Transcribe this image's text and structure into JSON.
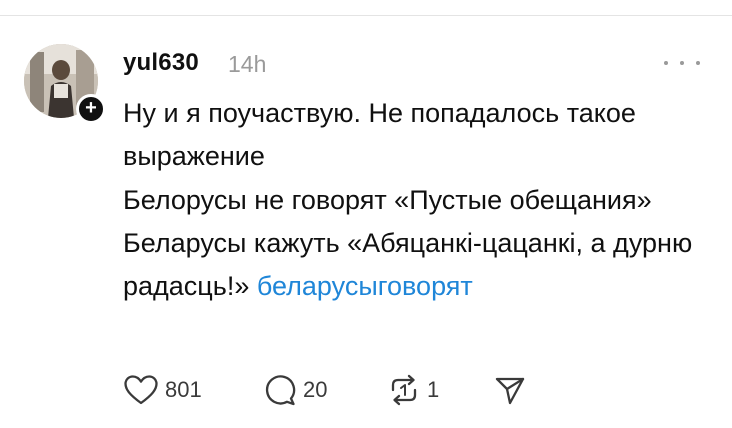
{
  "post": {
    "username": "yul630",
    "timestamp": "14h",
    "lines": [
      "Ну и я поучаствую. Не попадалось такое выражение",
      "Белорусы не говорят «Пустые обещания»"
    ],
    "last_line": "Беларусы кажуть «Абяцанкі-цацанкі, а дурню радасць!»",
    "hashtag": "беларусыговорят"
  },
  "actions": {
    "likes": "801",
    "replies": "20",
    "reposts": "1"
  },
  "icons": {
    "more": "more-horizontal-icon",
    "like": "heart-icon",
    "reply": "speech-bubble-icon",
    "repost": "repost-icon",
    "share": "send-icon",
    "follow": "plus-icon"
  },
  "colors": {
    "text": "#101010",
    "muted": "#9a9a9a",
    "hashtag": "#1f86d8",
    "badge": "#101010"
  }
}
